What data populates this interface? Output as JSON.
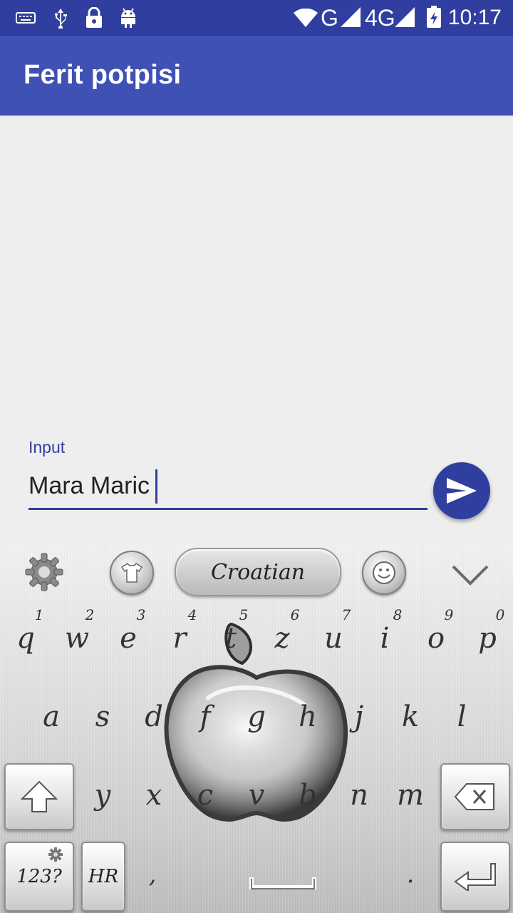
{
  "status_bar": {
    "time": "10:17",
    "network_g": "G",
    "network_4g": "4G",
    "icons": [
      "keyboard-icon",
      "usb-icon",
      "lock-icon",
      "android-icon",
      "wifi-icon",
      "signal-icon",
      "signal-icon",
      "battery-charging-icon"
    ]
  },
  "app_bar": {
    "title": "Ferit potpisi"
  },
  "input": {
    "label": "Input",
    "value": "Mara Maric"
  },
  "send_button": {
    "icon": "send-icon"
  },
  "keyboard": {
    "toolbar": {
      "language": "Croatian"
    },
    "row1": [
      {
        "num": "1",
        "key": "q"
      },
      {
        "num": "2",
        "key": "w"
      },
      {
        "num": "3",
        "key": "e"
      },
      {
        "num": "4",
        "key": "r"
      },
      {
        "num": "5",
        "key": "t"
      },
      {
        "num": "6",
        "key": "z"
      },
      {
        "num": "7",
        "key": "u"
      },
      {
        "num": "8",
        "key": "i"
      },
      {
        "num": "9",
        "key": "o"
      },
      {
        "num": "0",
        "key": "p"
      }
    ],
    "row2": [
      "a",
      "s",
      "d",
      "f",
      "g",
      "h",
      "j",
      "k",
      "l"
    ],
    "row3": [
      "y",
      "x",
      "c",
      "v",
      "b",
      "n",
      "m"
    ],
    "row4": {
      "symbols": "123?",
      "lang": "HR",
      "comma": ",",
      "period": "."
    }
  }
}
